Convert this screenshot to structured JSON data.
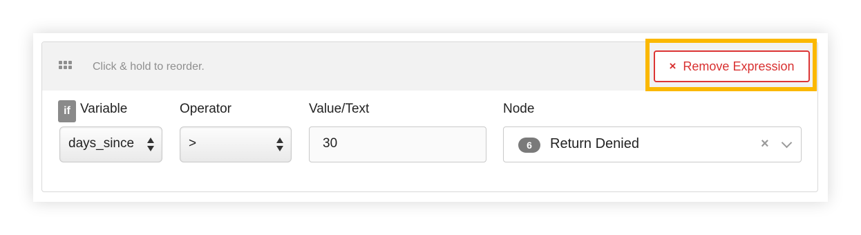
{
  "header": {
    "reorder_hint": "Click & hold to reorder.",
    "remove_label": "Remove Expression",
    "remove_icon": "×"
  },
  "expression": {
    "if_badge": "if",
    "variable": {
      "label": "Variable",
      "value": "days_since"
    },
    "operator": {
      "label": "Operator",
      "value": ">"
    },
    "value_text": {
      "label": "Value/Text",
      "value": "30"
    },
    "node": {
      "label": "Node",
      "badge": "6",
      "value": "Return Denied",
      "clear_icon": "×"
    }
  },
  "colors": {
    "highlight": "#fbb800",
    "remove_red": "#d83030",
    "header_bg": "#f2f2f2"
  }
}
